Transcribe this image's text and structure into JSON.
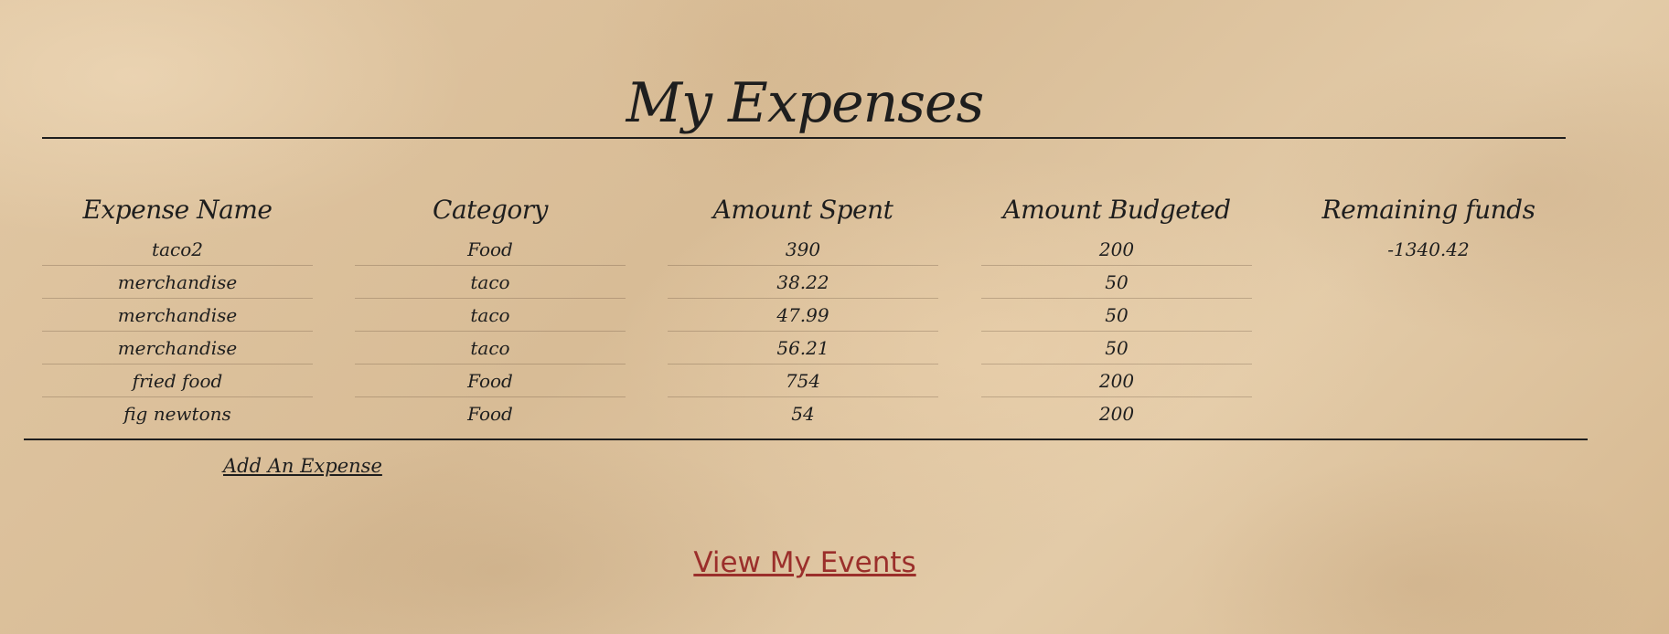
{
  "title": "My Expenses",
  "table": {
    "columns": [
      "Expense Name",
      "Category",
      "Amount Spent",
      "Amount Budgeted",
      "Remaining funds"
    ],
    "rows": [
      {
        "name": "taco2",
        "category": "Food",
        "spent": "390",
        "budgeted": "200"
      },
      {
        "name": "merchandise",
        "category": "taco",
        "spent": "38.22",
        "budgeted": "50"
      },
      {
        "name": "merchandise",
        "category": "taco",
        "spent": "47.99",
        "budgeted": "50"
      },
      {
        "name": "merchandise",
        "category": "taco",
        "spent": "56.21",
        "budgeted": "50"
      },
      {
        "name": "fried food",
        "category": "Food",
        "spent": "754",
        "budgeted": "200"
      },
      {
        "name": "fig newtons",
        "category": "Food",
        "spent": "54",
        "budgeted": "200"
      }
    ],
    "remaining_funds": "-1340.42"
  },
  "actions": {
    "add_expense": "Add An Expense",
    "view_events": "View My Events"
  },
  "colors": {
    "text": "#1e1e1e",
    "link_accent": "#9b2f2b",
    "background": "#dfc49f"
  }
}
